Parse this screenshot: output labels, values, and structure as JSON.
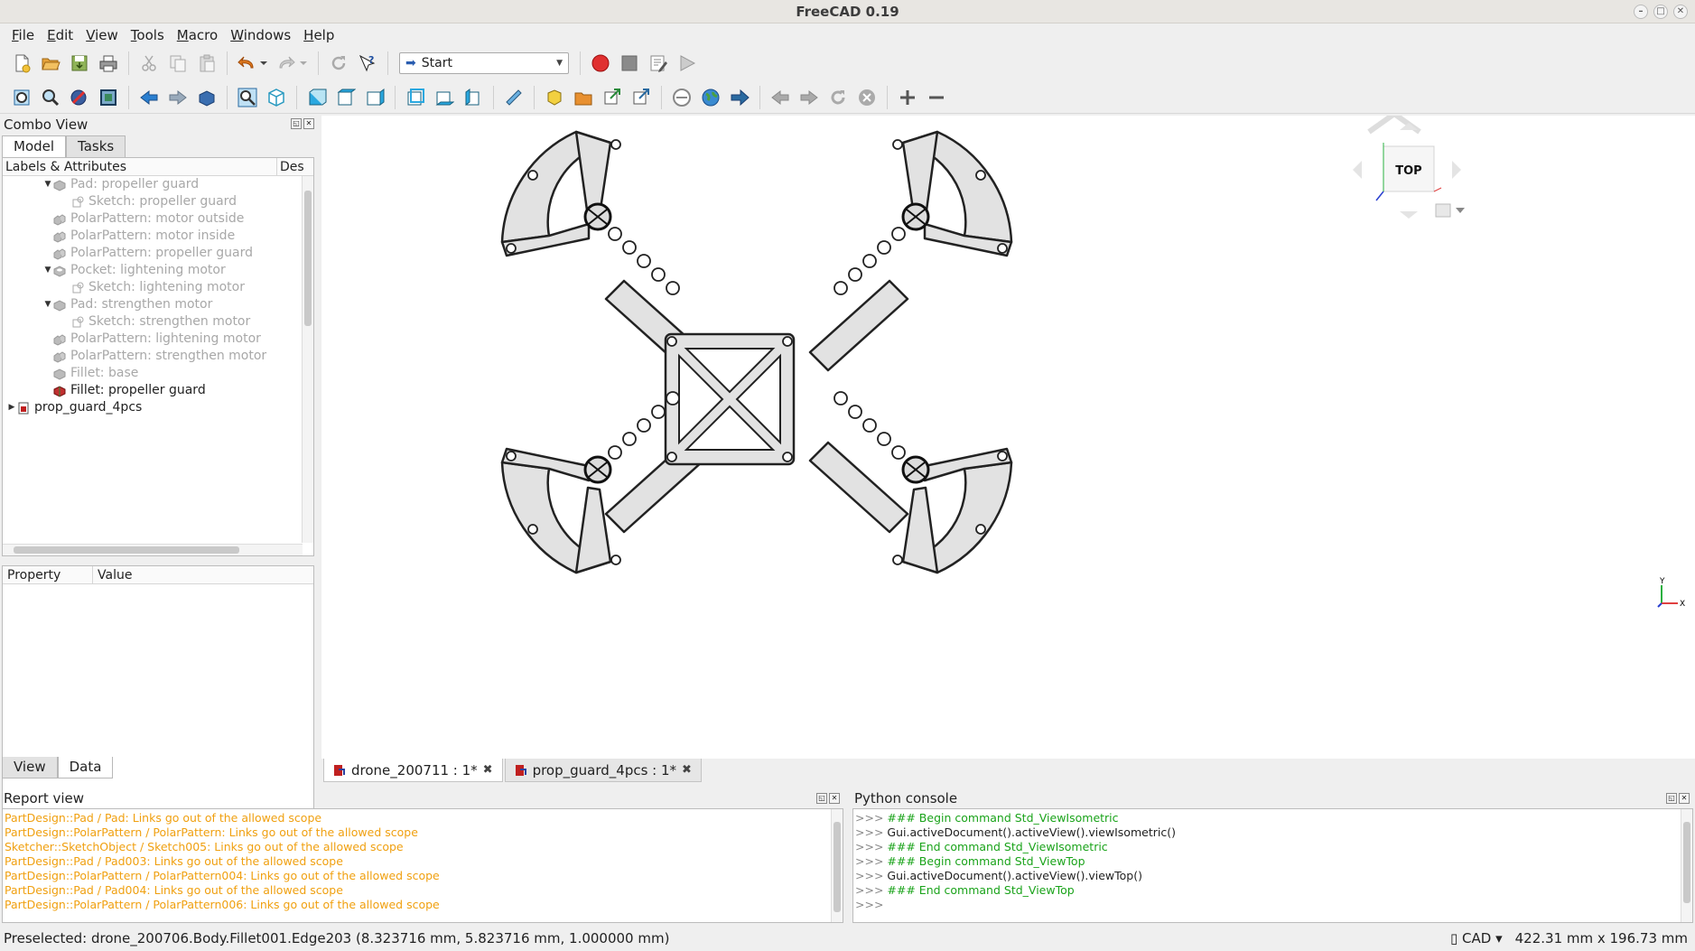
{
  "window": {
    "title": "FreeCAD 0.19",
    "controls": [
      "–",
      "□",
      "✕"
    ]
  },
  "menu": [
    {
      "label": "File",
      "accel": "F",
      "rest": "ile"
    },
    {
      "label": "Edit",
      "accel": "E",
      "rest": "dit"
    },
    {
      "label": "View",
      "accel": "V",
      "rest": "iew"
    },
    {
      "label": "Tools",
      "accel": "T",
      "rest": "ools"
    },
    {
      "label": "Macro",
      "accel": "M",
      "rest": "acro"
    },
    {
      "label": "Windows",
      "accel": "W",
      "rest": "indows"
    },
    {
      "label": "Help",
      "accel": "H",
      "rest": "elp"
    }
  ],
  "workbench": {
    "selected": "Start"
  },
  "comboview": {
    "title": "Combo View",
    "tabs": [
      "Model",
      "Tasks"
    ],
    "tree_header": [
      "Labels & Attributes",
      "Des"
    ],
    "tree_rows": [
      {
        "label": "Pad: propeller guard",
        "indent": 2,
        "twisty": "▼",
        "dim": true,
        "icon": "pad-icon"
      },
      {
        "label": "Sketch: propeller guard",
        "indent": 3,
        "twisty": "",
        "dim": true,
        "icon": "sketch-icon"
      },
      {
        "label": "PolarPattern: motor outside",
        "indent": 2,
        "twisty": "",
        "dim": true,
        "icon": "polarpattern-icon"
      },
      {
        "label": "PolarPattern: motor inside",
        "indent": 2,
        "twisty": "",
        "dim": true,
        "icon": "polarpattern-icon"
      },
      {
        "label": "PolarPattern: propeller guard",
        "indent": 2,
        "twisty": "",
        "dim": true,
        "icon": "polarpattern-icon"
      },
      {
        "label": "Pocket: lightening motor",
        "indent": 2,
        "twisty": "▼",
        "dim": true,
        "icon": "pocket-icon"
      },
      {
        "label": "Sketch: lightening motor",
        "indent": 3,
        "twisty": "",
        "dim": true,
        "icon": "sketch-icon"
      },
      {
        "label": "Pad: strengthen motor",
        "indent": 2,
        "twisty": "▼",
        "dim": true,
        "icon": "pad-icon"
      },
      {
        "label": "Sketch: strengthen motor",
        "indent": 3,
        "twisty": "",
        "dim": true,
        "icon": "sketch-icon"
      },
      {
        "label": "PolarPattern: lightening motor",
        "indent": 2,
        "twisty": "",
        "dim": true,
        "icon": "polarpattern-icon"
      },
      {
        "label": "PolarPattern: strengthen motor",
        "indent": 2,
        "twisty": "",
        "dim": true,
        "icon": "polarpattern-icon"
      },
      {
        "label": "Fillet: base",
        "indent": 2,
        "twisty": "",
        "dim": true,
        "icon": "fillet-icon"
      },
      {
        "label": "Fillet: propeller guard",
        "indent": 2,
        "twisty": "",
        "dim": false,
        "icon": "fillet-active-icon"
      },
      {
        "label": "prop_guard_4pcs",
        "indent": 0,
        "twisty": "▶",
        "dim": false,
        "icon": "document-icon"
      }
    ],
    "property_header": [
      "Property",
      "Value"
    ],
    "view_tabs": [
      "View",
      "Data"
    ]
  },
  "doc_tabs": [
    {
      "label": "drone_200711 : 1*",
      "active": true
    },
    {
      "label": "prop_guard_4pcs : 1*",
      "active": false
    }
  ],
  "navcube": {
    "face": "TOP"
  },
  "report": {
    "title": "Report view",
    "lines": [
      "PartDesign::Pad / Pad: Links go out of the allowed scope",
      "PartDesign::PolarPattern / PolarPattern: Links go out of the allowed scope",
      "Sketcher::SketchObject / Sketch005: Links go out of the allowed scope",
      "PartDesign::Pad / Pad003: Links go out of the allowed scope",
      "PartDesign::PolarPattern / PolarPattern004: Links go out of the allowed scope",
      "PartDesign::Pad / Pad004: Links go out of the allowed scope",
      "PartDesign::PolarPattern / PolarPattern006: Links go out of the allowed scope"
    ]
  },
  "python": {
    "title": "Python console",
    "lines": [
      {
        "prompt": ">>>",
        "text": "### Begin command Std_ViewIsometric",
        "kind": "comment"
      },
      {
        "prompt": ">>>",
        "text": "Gui.activeDocument().activeView().viewIsometric()",
        "kind": "code"
      },
      {
        "prompt": ">>>",
        "text": "### End command Std_ViewIsometric",
        "kind": "comment"
      },
      {
        "prompt": ">>>",
        "text": "### Begin command Std_ViewTop",
        "kind": "comment"
      },
      {
        "prompt": ">>>",
        "text": "Gui.activeDocument().activeView().viewTop()",
        "kind": "code"
      },
      {
        "prompt": ">>>",
        "text": "### End command Std_ViewTop",
        "kind": "comment"
      },
      {
        "prompt": ">>>",
        "text": "",
        "kind": "code"
      }
    ]
  },
  "status": {
    "preselected": "Preselected: drone_200706.Body.Fillet001.Edge203 (8.323716 mm, 5.823716 mm, 1.000000 mm)",
    "nav_style": "CAD",
    "dimensions": "422.31 mm x 196.73 mm"
  },
  "colors": {
    "warning": "#f0a010",
    "comment": "#1aa31a",
    "record": "#e03030",
    "part_fill": "#e2e2e2"
  }
}
